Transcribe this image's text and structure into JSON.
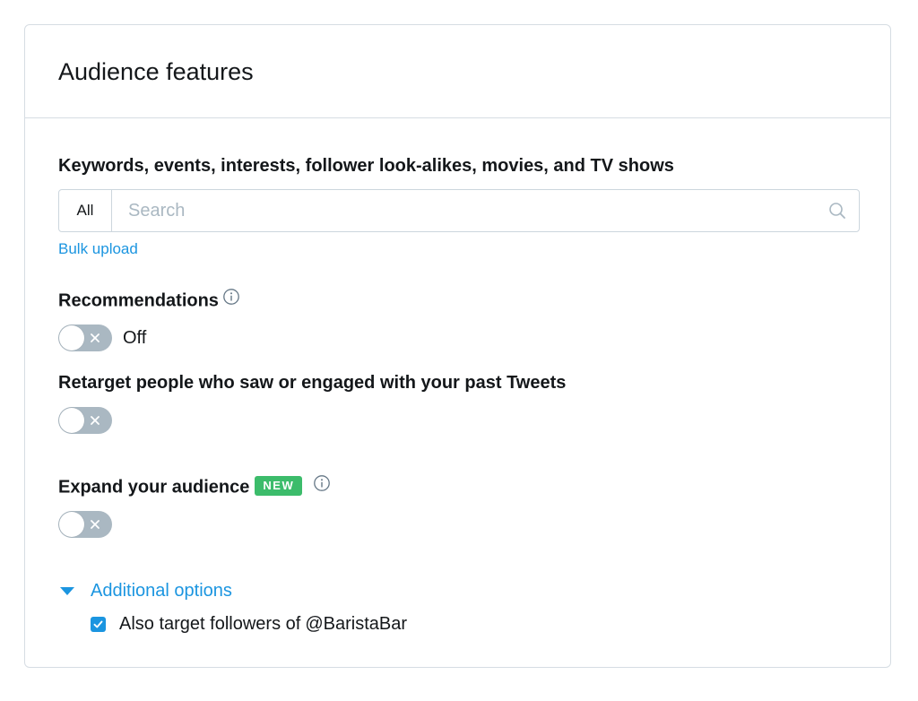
{
  "card": {
    "title": "Audience features"
  },
  "keywords": {
    "label": "Keywords, events, interests, follower look-alikes, movies, and TV shows",
    "scope_label": "All",
    "search_placeholder": "Search",
    "search_value": "",
    "bulk_upload_label": "Bulk upload"
  },
  "recommendations": {
    "label": "Recommendations",
    "toggle_state": "Off",
    "toggle_on": false
  },
  "retarget": {
    "label": "Retarget people who saw or engaged with your past Tweets",
    "toggle_on": false
  },
  "expand": {
    "label": "Expand your audience",
    "badge": "NEW",
    "toggle_on": false
  },
  "additional_options": {
    "label": "Additional options",
    "expanded": true,
    "followers_checkbox": {
      "label": "Also target followers of",
      "handle": "@BaristaBar",
      "checked": true
    }
  },
  "colors": {
    "accent": "#1b95e0",
    "new_badge": "#3cbc6b",
    "toggle_off": "#aab8c2",
    "border": "#d6dde3"
  },
  "icons": {
    "search": "search-icon",
    "info": "info-icon",
    "toggle_off": "x-icon",
    "caret": "caret-down-icon",
    "checkmark": "checkmark-icon"
  }
}
